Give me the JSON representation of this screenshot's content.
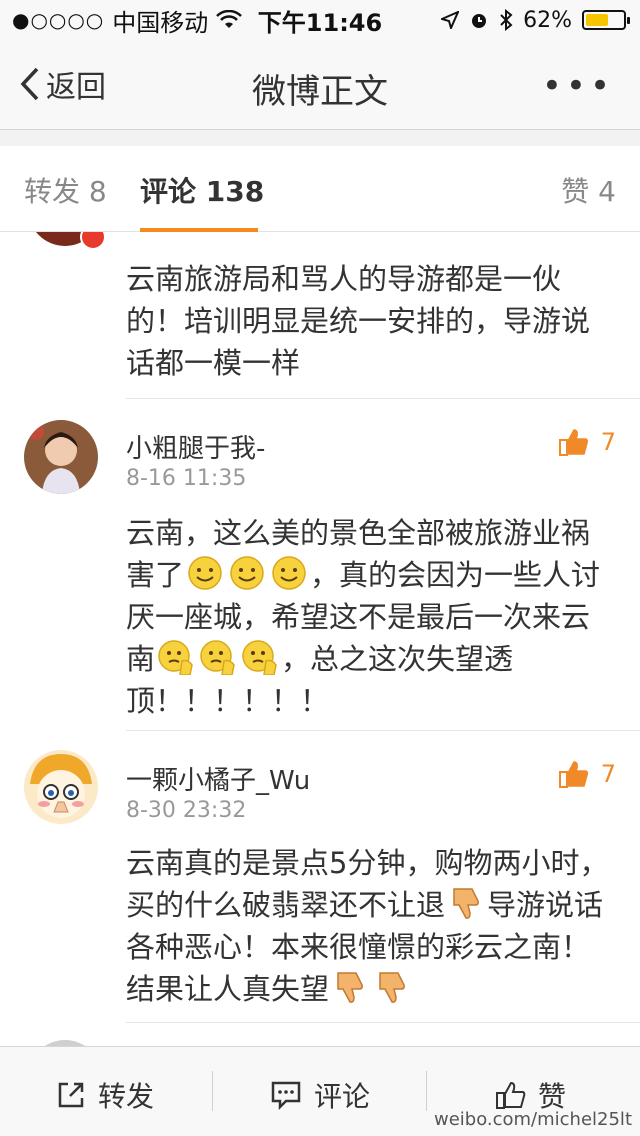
{
  "status_bar": {
    "signal_dots": "●○○○○",
    "carrier": "中国移动",
    "time": "下午11:46",
    "battery": "62%",
    "battery_level": 0.62
  },
  "nav": {
    "back_label": "返回",
    "title": "微博正文",
    "more": "•••"
  },
  "tabs": {
    "repost": "转发 8",
    "comments": "评论 138",
    "likes": "赞 4"
  },
  "comments": [
    {
      "text": "云南旅游局和骂人的导游都是一伙的！培训明显是统一安排的，导游说话都一模一样"
    },
    {
      "name": "小粗腿于我-",
      "time": "8-16 11:35",
      "likes": "7",
      "text1": "云南，这么美的景色全部被旅游业祸害了",
      "text2": "，真的会因为一些人讨厌一座城，希望这不是最后一次来云南",
      "text3": "，总之这次失望透顶！！！！！！"
    },
    {
      "name": "一颗小橘子_Wu",
      "time": "8-30 23:32",
      "likes": "7",
      "text1": "云南真的是景点5分钟，购物两小时，买的什么破翡翠还不让退",
      "text2": "导游说话各种恶心！本来很憧憬的彩云之南！结果让人真失望"
    }
  ],
  "bottom_bar": {
    "repost": "转发",
    "comment": "评论",
    "like": "赞"
  },
  "watermark": "weibo.com/michel25lt"
}
